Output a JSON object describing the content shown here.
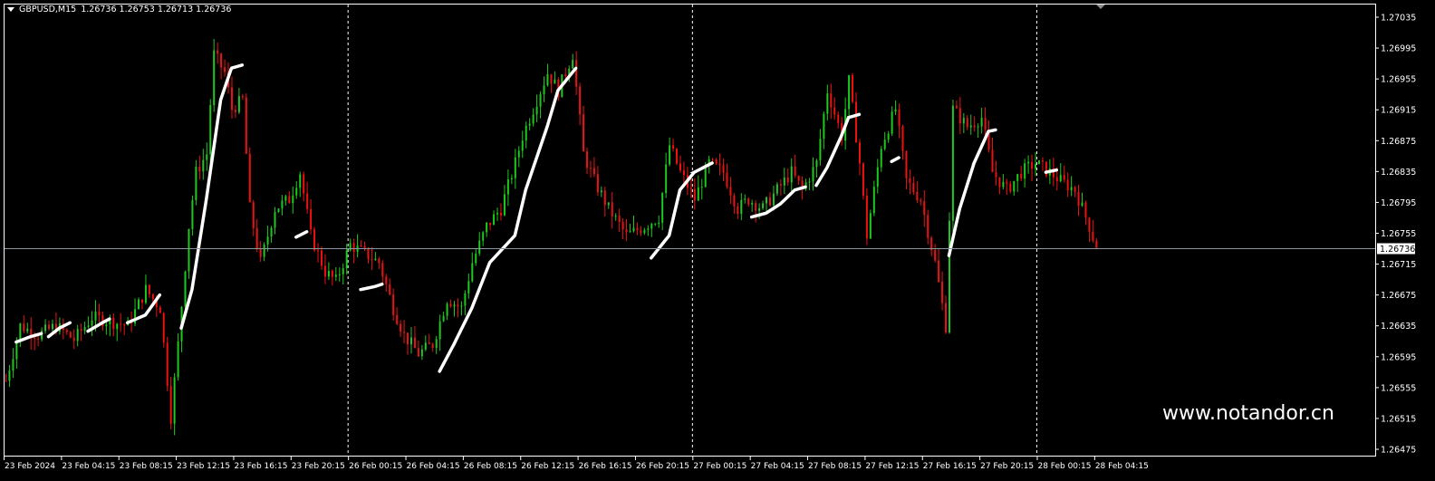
{
  "header": {
    "symbol": "GBPUSD,M15",
    "ohlc": "1.26736 1.26753 1.26713 1.26736"
  },
  "watermark": "www.notandor.cn",
  "colors": {
    "background": "#000000",
    "bull": "#1ec81e",
    "bear": "#ee1111",
    "indicator": "#ffffff",
    "grid": "#ffffff",
    "bid_line": "#8c96a0"
  },
  "chart_data": {
    "type": "candlestick",
    "timeframe": "M15",
    "ylim": [
      1.2646,
      1.2705
    ],
    "grid": false,
    "current_price": 1.26736,
    "y_ticks": [
      "1.27035",
      "1.26995",
      "1.26955",
      "1.26915",
      "1.26875",
      "1.26835",
      "1.26795",
      "1.26755",
      "1.26715",
      "1.26675",
      "1.26635",
      "1.26595",
      "1.26555",
      "1.26515",
      "1.26475"
    ],
    "x_tick_every_bars": 16,
    "x_ticks": [
      "23 Feb 2024",
      "23 Feb 04:15",
      "23 Feb 08:15",
      "23 Feb 12:15",
      "23 Feb 16:15",
      "23 Feb 20:15",
      "26 Feb 00:15",
      "26 Feb 04:15",
      "26 Feb 08:15",
      "26 Feb 12:15",
      "26 Feb 16:15",
      "26 Feb 20:15",
      "27 Feb 00:15",
      "27 Feb 04:15",
      "27 Feb 08:15",
      "27 Feb 12:15",
      "27 Feb 16:15",
      "27 Feb 20:15",
      "28 Feb 00:15",
      "28 Feb 04:15"
    ],
    "day_separators_bar": [
      95.5,
      191.5,
      287.5
    ],
    "approx_close_path": [
      [
        0,
        1.26564
      ],
      [
        4,
        1.26635
      ],
      [
        9,
        1.26623
      ],
      [
        14,
        1.26635
      ],
      [
        19,
        1.26617
      ],
      [
        24,
        1.26646
      ],
      [
        29,
        1.26641
      ],
      [
        34,
        1.26635
      ],
      [
        39,
        1.26682
      ],
      [
        43,
        1.26658
      ],
      [
        46,
        1.26517
      ],
      [
        48,
        1.26611
      ],
      [
        51,
        1.26764
      ],
      [
        53,
        1.26834
      ],
      [
        56,
        1.26858
      ],
      [
        58,
        1.26987
      ],
      [
        61,
        1.26963
      ],
      [
        63,
        1.26916
      ],
      [
        66,
        1.26928
      ],
      [
        68,
        1.26787
      ],
      [
        71,
        1.26717
      ],
      [
        75,
        1.26787
      ],
      [
        79,
        1.26799
      ],
      [
        82,
        1.26834
      ],
      [
        85,
        1.26752
      ],
      [
        89,
        1.26705
      ],
      [
        92,
        1.26693
      ],
      [
        96,
        1.2674
      ],
      [
        100,
        1.26729
      ],
      [
        104,
        1.26717
      ],
      [
        108,
        1.26658
      ],
      [
        111,
        1.26623
      ],
      [
        115,
        1.26599
      ],
      [
        119,
        1.26611
      ],
      [
        123,
        1.2667
      ],
      [
        127,
        1.26658
      ],
      [
        130,
        1.26717
      ],
      [
        134,
        1.26764
      ],
      [
        138,
        1.26787
      ],
      [
        142,
        1.26846
      ],
      [
        144,
        1.26881
      ],
      [
        148,
        1.26928
      ],
      [
        151,
        1.26963
      ],
      [
        154,
        1.2694
      ],
      [
        158,
        1.26987
      ],
      [
        161,
        1.26858
      ],
      [
        164,
        1.26823
      ],
      [
        168,
        1.26787
      ],
      [
        173,
        1.26752
      ],
      [
        178,
        1.26764
      ],
      [
        182,
        1.26776
      ],
      [
        185,
        1.26869
      ],
      [
        188,
        1.26834
      ],
      [
        192,
        1.26799
      ],
      [
        196,
        1.26846
      ],
      [
        200,
        1.26834
      ],
      [
        204,
        1.26787
      ],
      [
        207,
        1.26799
      ],
      [
        211,
        1.26787
      ],
      [
        215,
        1.26811
      ],
      [
        219,
        1.26834
      ],
      [
        222,
        1.26811
      ],
      [
        226,
        1.26846
      ],
      [
        229,
        1.2694
      ],
      [
        233,
        1.26881
      ],
      [
        235,
        1.26952
      ],
      [
        238,
        1.26846
      ],
      [
        240,
        1.26752
      ],
      [
        244,
        1.26869
      ],
      [
        248,
        1.26916
      ],
      [
        251,
        1.26823
      ],
      [
        255,
        1.26799
      ],
      [
        259,
        1.26717
      ],
      [
        262,
        1.26635
      ],
      [
        264,
        1.26916
      ],
      [
        268,
        1.26893
      ],
      [
        272,
        1.26905
      ],
      [
        275,
        1.26834
      ],
      [
        279,
        1.26811
      ],
      [
        283,
        1.26834
      ],
      [
        287,
        1.26846
      ],
      [
        291,
        1.26834
      ],
      [
        294,
        1.26823
      ],
      [
        298,
        1.26811
      ],
      [
        302,
        1.26764
      ],
      [
        304,
        1.26736
      ]
    ],
    "indicator_segments": [
      [
        [
          3,
          1.26614
        ],
        [
          7,
          1.26621
        ],
        [
          10,
          1.26625
        ]
      ],
      [
        [
          12,
          1.26621
        ],
        [
          15,
          1.26632
        ],
        [
          18,
          1.26639
        ]
      ],
      [
        [
          23,
          1.26628
        ],
        [
          27,
          1.26639
        ],
        [
          29,
          1.26644
        ]
      ],
      [
        [
          34,
          1.26639
        ],
        [
          39,
          1.26649
        ],
        [
          43,
          1.26675
        ]
      ],
      [
        [
          49,
          1.26632
        ],
        [
          52,
          1.26682
        ],
        [
          56,
          1.26799
        ],
        [
          60,
          1.26928
        ],
        [
          63,
          1.26969
        ],
        [
          66,
          1.26973
        ]
      ],
      [
        [
          81,
          1.2675
        ],
        [
          84,
          1.26757
        ]
      ],
      [
        [
          99,
          1.26682
        ],
        [
          103,
          1.26686
        ],
        [
          105,
          1.26689
        ]
      ],
      [
        [
          121,
          1.26576
        ],
        [
          125,
          1.26611
        ],
        [
          130,
          1.26658
        ],
        [
          135,
          1.26717
        ],
        [
          142,
          1.26752
        ],
        [
          145,
          1.26811
        ],
        [
          151,
          1.26893
        ],
        [
          154,
          1.2694
        ],
        [
          159,
          1.26969
        ]
      ],
      [
        [
          180,
          1.26723
        ],
        [
          185,
          1.26752
        ],
        [
          188,
          1.26811
        ],
        [
          192,
          1.26834
        ],
        [
          197,
          1.26846
        ]
      ],
      [
        [
          208,
          1.26776
        ],
        [
          212,
          1.26781
        ],
        [
          216,
          1.26793
        ],
        [
          220,
          1.26811
        ],
        [
          223,
          1.26815
        ]
      ],
      [
        [
          226,
          1.26817
        ],
        [
          229,
          1.2684
        ],
        [
          233,
          1.26881
        ],
        [
          235,
          1.26905
        ],
        [
          238,
          1.26909
        ]
      ],
      [
        [
          247,
          1.26848
        ],
        [
          249,
          1.26853
        ]
      ],
      [
        [
          263,
          1.26726
        ],
        [
          266,
          1.26787
        ],
        [
          270,
          1.26846
        ],
        [
          274,
          1.26887
        ],
        [
          276,
          1.26889
        ]
      ],
      [
        [
          290,
          1.26834
        ],
        [
          293,
          1.26837
        ]
      ]
    ]
  }
}
